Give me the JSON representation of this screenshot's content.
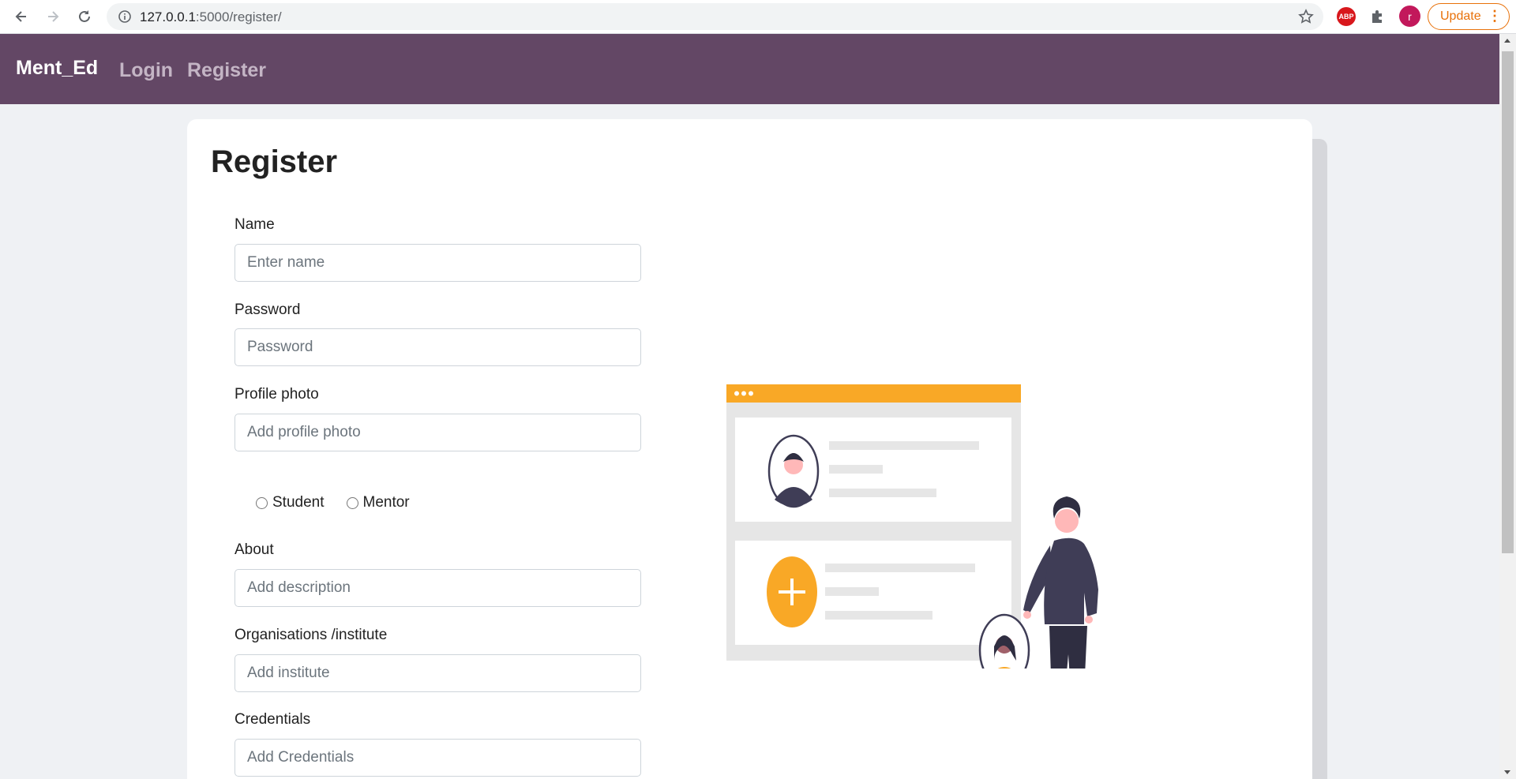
{
  "browser": {
    "url_host": "127.0.0.1",
    "url_path": ":5000/register/",
    "update_label": "Update",
    "avatar_letter": "r",
    "abp_label": "ABP"
  },
  "navbar": {
    "brand": "Ment_Ed",
    "links": [
      "Login",
      "Register"
    ]
  },
  "form": {
    "title": "Register",
    "fields": [
      {
        "label": "Name",
        "placeholder": "Enter name"
      },
      {
        "label": "Password",
        "placeholder": "Password"
      },
      {
        "label": "Profile photo",
        "placeholder": "Add profile photo"
      },
      {
        "label": "About",
        "placeholder": "Add description"
      },
      {
        "label": "Organisations /institute",
        "placeholder": "Add institute"
      },
      {
        "label": "Credentials",
        "placeholder": "Add Credentials"
      }
    ],
    "role_options": [
      "Student",
      "Mentor"
    ]
  },
  "colors": {
    "navbar": "#634765",
    "accent": "#f9a826",
    "figure": "#3f3d56"
  }
}
